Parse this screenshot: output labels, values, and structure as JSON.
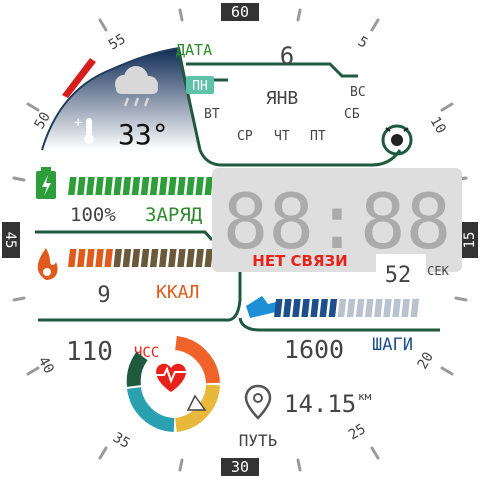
{
  "bezel": {
    "top": "60",
    "right": "15",
    "bottom": "30",
    "left": "45",
    "n5": "5",
    "n10": "10",
    "n20": "20",
    "n25": "25",
    "n35": "35",
    "n40": "40",
    "n50": "50",
    "n55": "55"
  },
  "date": {
    "label": "ДАТА",
    "day": "6",
    "month": "ЯНВ",
    "weekdays": [
      "ПН",
      "ВТ",
      "СР",
      "ЧТ",
      "ПТ",
      "СБ",
      "ВС"
    ],
    "active_weekday": "ПН"
  },
  "weather": {
    "temperature": "33°",
    "sign": "+",
    "icon": "cloud-rain-icon"
  },
  "battery": {
    "percent_text": "100%",
    "label": "ЗАРЯД",
    "level": 1.0,
    "icon": "battery-icon",
    "color": "#2e9e3a"
  },
  "calories": {
    "value": "9",
    "label": "ККАЛ",
    "icon": "flame-icon",
    "color": "#e05a1c"
  },
  "time": {
    "display": "88:88",
    "seconds": "52",
    "seconds_label": "СЕК",
    "status": "НЕТ СВЯЗИ"
  },
  "steps": {
    "value": "1600",
    "label": "ШАГИ",
    "icon": "shoe-icon",
    "color": "#1d4f8c"
  },
  "heart": {
    "value": "110",
    "label": "ЧСС",
    "icon": "heart-rate-icon"
  },
  "distance": {
    "value": "14.15",
    "unit": "км",
    "label": "ПУТЬ",
    "icon": "location-pin-icon"
  },
  "colors": {
    "accent_green": "#1f5a3f",
    "red": "#e8221b",
    "battery_green": "#2e9e3a",
    "calorie_orange": "#e05a1c",
    "steps_blue": "#1d4f8c"
  }
}
